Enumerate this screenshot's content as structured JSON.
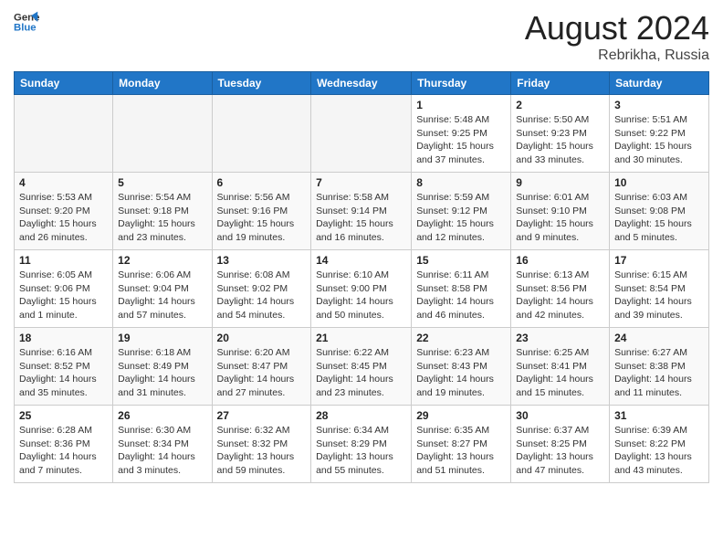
{
  "header": {
    "logo_line1": "General",
    "logo_line2": "Blue",
    "month": "August 2024",
    "location": "Rebrikha, Russia"
  },
  "weekdays": [
    "Sunday",
    "Monday",
    "Tuesday",
    "Wednesday",
    "Thursday",
    "Friday",
    "Saturday"
  ],
  "weeks": [
    [
      {
        "day": "",
        "detail": ""
      },
      {
        "day": "",
        "detail": ""
      },
      {
        "day": "",
        "detail": ""
      },
      {
        "day": "",
        "detail": ""
      },
      {
        "day": "1",
        "detail": "Sunrise: 5:48 AM\nSunset: 9:25 PM\nDaylight: 15 hours\nand 37 minutes."
      },
      {
        "day": "2",
        "detail": "Sunrise: 5:50 AM\nSunset: 9:23 PM\nDaylight: 15 hours\nand 33 minutes."
      },
      {
        "day": "3",
        "detail": "Sunrise: 5:51 AM\nSunset: 9:22 PM\nDaylight: 15 hours\nand 30 minutes."
      }
    ],
    [
      {
        "day": "4",
        "detail": "Sunrise: 5:53 AM\nSunset: 9:20 PM\nDaylight: 15 hours\nand 26 minutes."
      },
      {
        "day": "5",
        "detail": "Sunrise: 5:54 AM\nSunset: 9:18 PM\nDaylight: 15 hours\nand 23 minutes."
      },
      {
        "day": "6",
        "detail": "Sunrise: 5:56 AM\nSunset: 9:16 PM\nDaylight: 15 hours\nand 19 minutes."
      },
      {
        "day": "7",
        "detail": "Sunrise: 5:58 AM\nSunset: 9:14 PM\nDaylight: 15 hours\nand 16 minutes."
      },
      {
        "day": "8",
        "detail": "Sunrise: 5:59 AM\nSunset: 9:12 PM\nDaylight: 15 hours\nand 12 minutes."
      },
      {
        "day": "9",
        "detail": "Sunrise: 6:01 AM\nSunset: 9:10 PM\nDaylight: 15 hours\nand 9 minutes."
      },
      {
        "day": "10",
        "detail": "Sunrise: 6:03 AM\nSunset: 9:08 PM\nDaylight: 15 hours\nand 5 minutes."
      }
    ],
    [
      {
        "day": "11",
        "detail": "Sunrise: 6:05 AM\nSunset: 9:06 PM\nDaylight: 15 hours\nand 1 minute."
      },
      {
        "day": "12",
        "detail": "Sunrise: 6:06 AM\nSunset: 9:04 PM\nDaylight: 14 hours\nand 57 minutes."
      },
      {
        "day": "13",
        "detail": "Sunrise: 6:08 AM\nSunset: 9:02 PM\nDaylight: 14 hours\nand 54 minutes."
      },
      {
        "day": "14",
        "detail": "Sunrise: 6:10 AM\nSunset: 9:00 PM\nDaylight: 14 hours\nand 50 minutes."
      },
      {
        "day": "15",
        "detail": "Sunrise: 6:11 AM\nSunset: 8:58 PM\nDaylight: 14 hours\nand 46 minutes."
      },
      {
        "day": "16",
        "detail": "Sunrise: 6:13 AM\nSunset: 8:56 PM\nDaylight: 14 hours\nand 42 minutes."
      },
      {
        "day": "17",
        "detail": "Sunrise: 6:15 AM\nSunset: 8:54 PM\nDaylight: 14 hours\nand 39 minutes."
      }
    ],
    [
      {
        "day": "18",
        "detail": "Sunrise: 6:16 AM\nSunset: 8:52 PM\nDaylight: 14 hours\nand 35 minutes."
      },
      {
        "day": "19",
        "detail": "Sunrise: 6:18 AM\nSunset: 8:49 PM\nDaylight: 14 hours\nand 31 minutes."
      },
      {
        "day": "20",
        "detail": "Sunrise: 6:20 AM\nSunset: 8:47 PM\nDaylight: 14 hours\nand 27 minutes."
      },
      {
        "day": "21",
        "detail": "Sunrise: 6:22 AM\nSunset: 8:45 PM\nDaylight: 14 hours\nand 23 minutes."
      },
      {
        "day": "22",
        "detail": "Sunrise: 6:23 AM\nSunset: 8:43 PM\nDaylight: 14 hours\nand 19 minutes."
      },
      {
        "day": "23",
        "detail": "Sunrise: 6:25 AM\nSunset: 8:41 PM\nDaylight: 14 hours\nand 15 minutes."
      },
      {
        "day": "24",
        "detail": "Sunrise: 6:27 AM\nSunset: 8:38 PM\nDaylight: 14 hours\nand 11 minutes."
      }
    ],
    [
      {
        "day": "25",
        "detail": "Sunrise: 6:28 AM\nSunset: 8:36 PM\nDaylight: 14 hours\nand 7 minutes."
      },
      {
        "day": "26",
        "detail": "Sunrise: 6:30 AM\nSunset: 8:34 PM\nDaylight: 14 hours\nand 3 minutes."
      },
      {
        "day": "27",
        "detail": "Sunrise: 6:32 AM\nSunset: 8:32 PM\nDaylight: 13 hours\nand 59 minutes."
      },
      {
        "day": "28",
        "detail": "Sunrise: 6:34 AM\nSunset: 8:29 PM\nDaylight: 13 hours\nand 55 minutes."
      },
      {
        "day": "29",
        "detail": "Sunrise: 6:35 AM\nSunset: 8:27 PM\nDaylight: 13 hours\nand 51 minutes."
      },
      {
        "day": "30",
        "detail": "Sunrise: 6:37 AM\nSunset: 8:25 PM\nDaylight: 13 hours\nand 47 minutes."
      },
      {
        "day": "31",
        "detail": "Sunrise: 6:39 AM\nSunset: 8:22 PM\nDaylight: 13 hours\nand 43 minutes."
      }
    ]
  ]
}
